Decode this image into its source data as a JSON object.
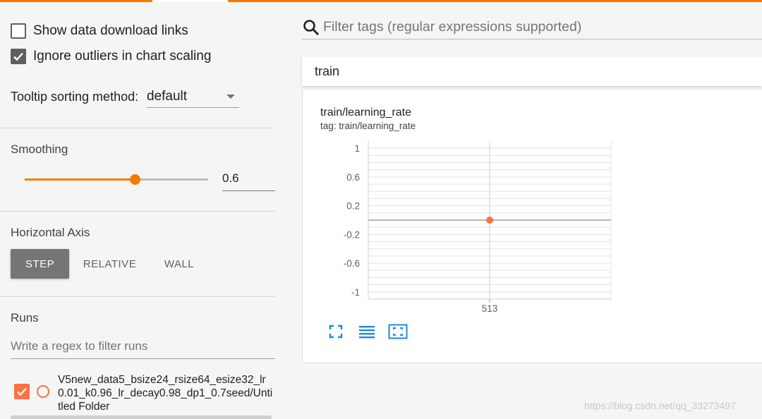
{
  "sidebar": {
    "show_download_label": "Show data download links",
    "show_download_checked": false,
    "ignore_outliers_label": "Ignore outliers in chart scaling",
    "ignore_outliers_checked": true,
    "tooltip_label": "Tooltip sorting method:",
    "tooltip_value": "default",
    "smoothing": {
      "title": "Smoothing",
      "value": "0.6",
      "fraction": 0.6
    },
    "horizontal_axis": {
      "title": "Horizontal Axis",
      "options": [
        "STEP",
        "RELATIVE",
        "WALL"
      ],
      "selected": "STEP"
    },
    "runs": {
      "title": "Runs",
      "filter_placeholder": "Write a regex to filter runs",
      "items": [
        {
          "name": "V5new_data5_bsize24_rsize64_esize32_lr0.01_k0.96_lr_decay0.98_dp1_0.7seed/Untitled Folder",
          "checked": true
        }
      ]
    }
  },
  "search": {
    "placeholder": "Filter tags (regular expressions supported)"
  },
  "panel": {
    "group_name": "train",
    "card": {
      "title": "train/learning_rate",
      "subtitle": "tag: train/learning_rate"
    }
  },
  "chart_data": {
    "type": "line",
    "title": "train/learning_rate",
    "xlabel": "",
    "ylabel": "",
    "x_ticks": [
      "513"
    ],
    "y_ticks": [
      "1",
      "0.6",
      "0.2",
      "-0.2",
      "-0.6",
      "-1"
    ],
    "ylim": [
      -1.1,
      1.1
    ],
    "grid": true,
    "series": [
      {
        "x": [
          513
        ],
        "y": [
          0.0
        ],
        "color": "#ff7043"
      }
    ]
  },
  "colors": {
    "accent": "#f57c00",
    "run": "#ff7043",
    "tool_icons": "#1e88e5"
  },
  "watermark": "https://blog.csdn.net/qq_33273497"
}
